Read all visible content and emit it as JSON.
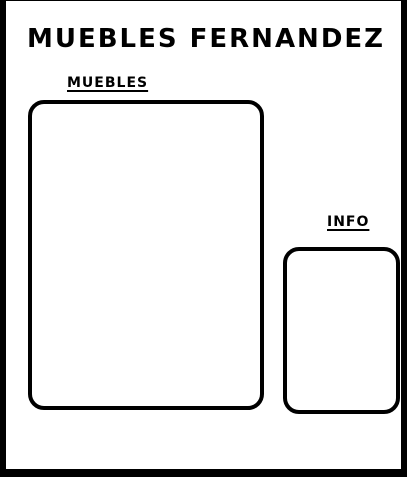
{
  "header": {
    "title": "MUEBLES FERNANDEZ"
  },
  "sections": {
    "muebles": {
      "label": "MUEBLES"
    },
    "info": {
      "label": "INFO"
    }
  },
  "colors": {
    "border": "#000000",
    "background": "#ffffff",
    "text": "#000000"
  }
}
